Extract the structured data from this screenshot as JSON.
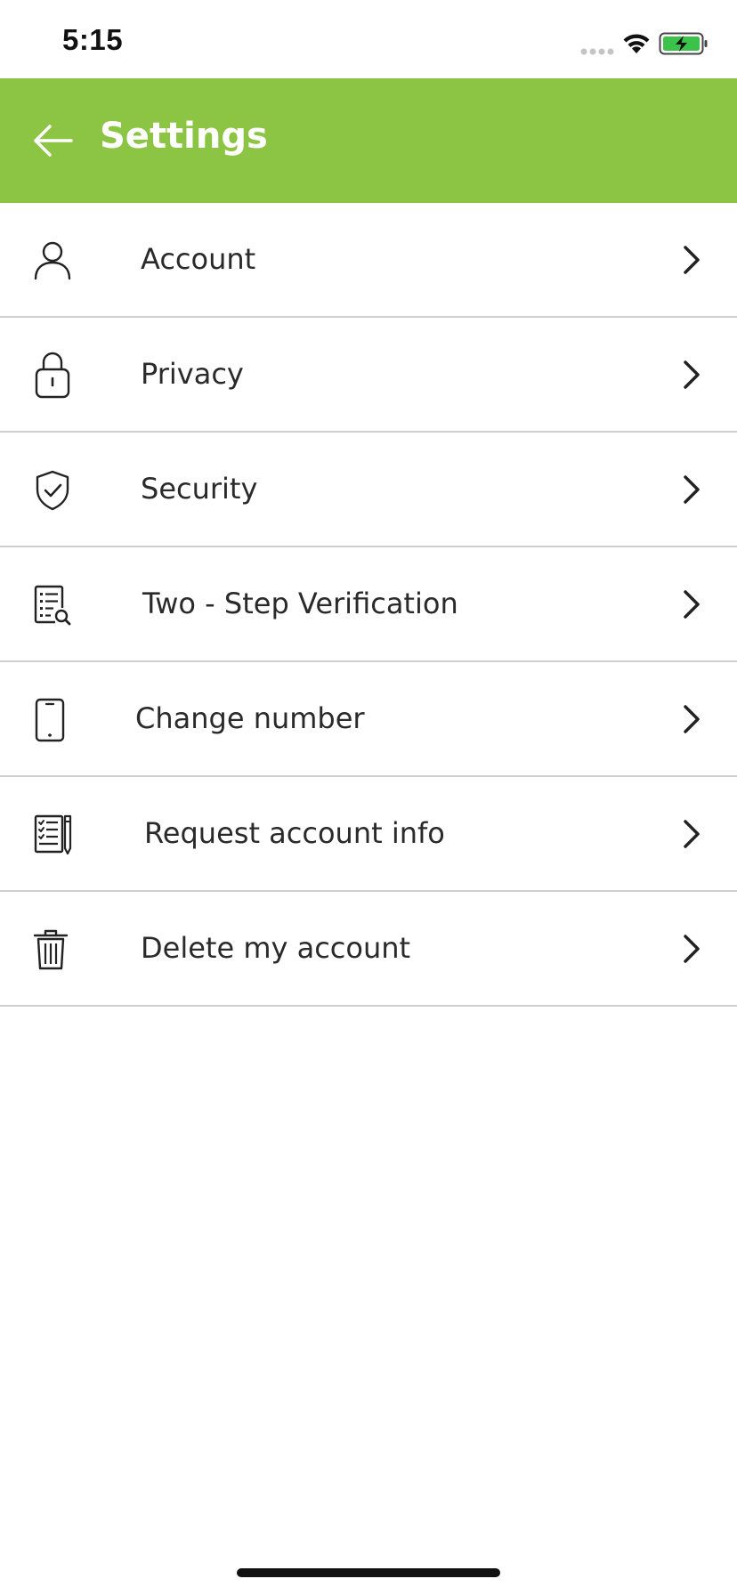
{
  "status_bar": {
    "time": "5:15"
  },
  "header": {
    "title": "Settings",
    "back_icon": "arrow-left-icon",
    "background": "#8cc443"
  },
  "settings": {
    "items": [
      {
        "label": "Account",
        "icon": "user-icon"
      },
      {
        "label": "Privacy",
        "icon": "lock-icon"
      },
      {
        "label": "Security",
        "icon": "shield-check-icon"
      },
      {
        "label": "Two - Step Verification",
        "icon": "document-search-icon"
      },
      {
        "label": "Change number",
        "icon": "phone-icon"
      },
      {
        "label": "Request account info",
        "icon": "checklist-icon"
      },
      {
        "label": "Delete my account",
        "icon": "trash-icon"
      }
    ]
  }
}
